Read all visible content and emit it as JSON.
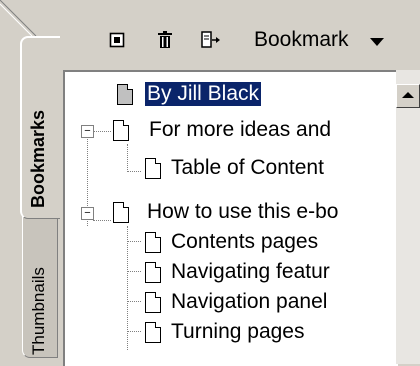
{
  "tabs": {
    "bookmarks": "Bookmarks",
    "thumbnails": "Thumbnails"
  },
  "toolbar": {
    "new_icon": "new-bookmark-icon",
    "delete_icon": "trash-icon",
    "expand_icon": "expand-bookmark-icon",
    "menu_label": "Bookmark"
  },
  "tree": {
    "items": [
      {
        "label": "By Jill Black",
        "selected": true
      },
      {
        "label": "For more ideas and"
      },
      {
        "label": "Table of Content"
      },
      {
        "label": "How to use this e-bo"
      },
      {
        "label": "Contents pages"
      },
      {
        "label": "Navigating featur"
      },
      {
        "label": "Navigation panel"
      },
      {
        "label": "Turning pages"
      }
    ]
  },
  "colors": {
    "background": "#d4d0c8",
    "selection": "#0a246a"
  }
}
